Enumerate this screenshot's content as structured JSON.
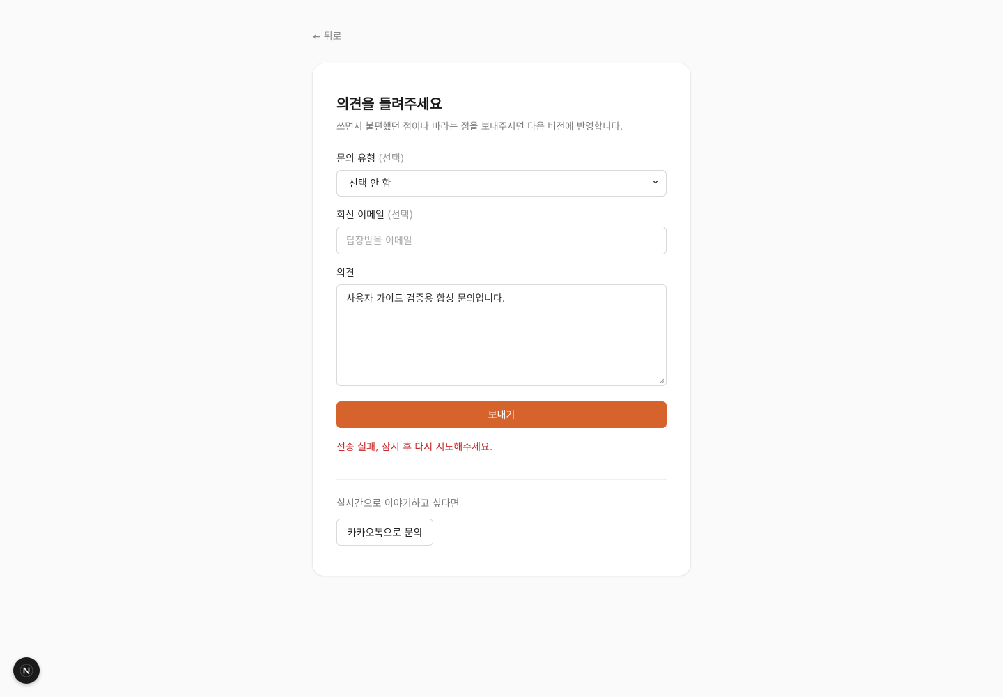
{
  "nav": {
    "back_arrow": "←",
    "back_label": "뒤로"
  },
  "form": {
    "title": "의견을 들려주세요",
    "subtitle": "쓰면서 불편했던 점이나 바라는 점을 보내주시면 다음 버전에 반영합니다.",
    "inquiry_type": {
      "label": "문의 유형",
      "optional": "(선택)",
      "selected_value": "선택 안 함"
    },
    "email": {
      "label": "회신 이메일",
      "optional": "(선택)",
      "placeholder": "답장받을 이메일",
      "value": ""
    },
    "opinion": {
      "label": "의견",
      "value": "사용자 가이드 검증용 합성 문의입니다."
    },
    "submit_label": "보내기",
    "error_message": "전송 실패, 잠시 후 다시 시도해주세요."
  },
  "realtime": {
    "text": "실시간으로 이야기하고 싶다면",
    "kakao_button_label": "카카오톡으로 문의"
  },
  "colors": {
    "accent": "#d6632b",
    "error": "#c62828",
    "background": "#fafafa"
  },
  "icons": {
    "back": "arrow-left-icon",
    "select": "chevron-down-icon",
    "badge": "nextjs-logo-icon"
  }
}
